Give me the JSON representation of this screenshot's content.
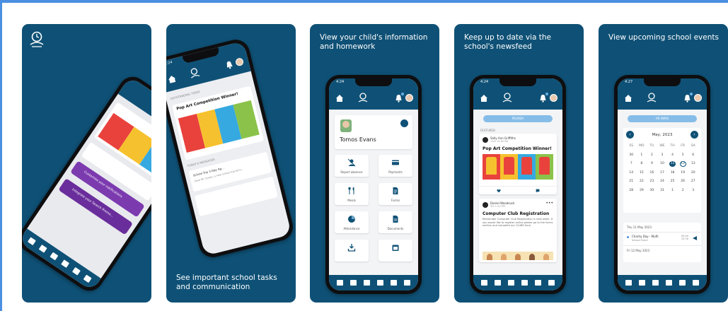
{
  "cards": [
    {
      "id": "logo"
    },
    {
      "id": "communication",
      "caption": "See important school tasks and communication"
    },
    {
      "id": "child-info",
      "caption": "View your child's information and homework"
    },
    {
      "id": "newsfeed",
      "caption": "Keep up to date via the school's newsfeed"
    },
    {
      "id": "events",
      "caption": "View upcoming school events"
    }
  ],
  "phones": {
    "time_a": "4:24",
    "time_b": "4:27"
  },
  "child_screen": {
    "child_name": "Tomos Evans",
    "tiles": [
      {
        "label": "Report absence",
        "icon": "person-off-icon"
      },
      {
        "label": "Payments",
        "icon": "card-icon"
      },
      {
        "label": "Meals",
        "icon": "cutlery-icon"
      },
      {
        "label": "Forms",
        "icon": "form-icon"
      },
      {
        "label": "Attendance",
        "icon": "pie-icon"
      },
      {
        "label": "Documents",
        "icon": "document-icon"
      },
      {
        "label": "",
        "icon": "download-icon"
      },
      {
        "label": "",
        "icon": "calendar-icon"
      }
    ]
  },
  "feed_screen": {
    "pill": "PEUADA",
    "featured": "FEATURED",
    "posts": [
      {
        "author": "Sally Ann Griffiths",
        "time": "14/5 12:00 PM",
        "title": "Pop Art Competition Winner!"
      },
      {
        "author": "Daniel Woodcock",
        "time": "9/5 1:30 PM",
        "title": "Computer Club Registration",
        "body": "Remember Computer Club Registration is next week. If you would like to register online please go to the forms section and complete our CLUBS form."
      }
    ],
    "art_colors": [
      "#e9423d",
      "#f6c12e",
      "#36a9e1",
      "#8bc34a"
    ]
  },
  "calendar_screen": {
    "pill": "AR AWAS",
    "month": "May, 2023",
    "weekdays": [
      "SS",
      "MO",
      "TU",
      "WE",
      "TH",
      "FR",
      "SA"
    ],
    "weeks": [
      [
        "30",
        "1",
        "2",
        "3",
        "4",
        "5",
        "6"
      ],
      [
        "7",
        "8",
        "9",
        "10",
        "11",
        "12",
        "13"
      ],
      [
        "14",
        "15",
        "16",
        "17",
        "18",
        "19",
        "20"
      ],
      [
        "21",
        "22",
        "23",
        "24",
        "25",
        "26",
        "27"
      ],
      [
        "28",
        "29",
        "30",
        "31",
        "1",
        "2",
        "3"
      ]
    ],
    "today": "11",
    "selected": "12",
    "events": [
      {
        "date": "Thu 11 May 2023"
      },
      {
        "title": "Charity Day - Mufti",
        "sub": "School Event",
        "time": "09:00\n15:30"
      },
      {
        "date": "Fri 12 May 2023"
      }
    ]
  },
  "tilted_screen": {
    "tasks_header": "OUTSTANDING TASKS",
    "announce_header": "TODAY'S MESSAGES",
    "banner_a": "Customise your notifications",
    "banner_b": "Integrate your Search Promo...",
    "post_title": "Pop Art Competition Winner!",
    "msg_line": "School Trip 3 Day Ag...",
    "msg_sub": "Dear Mr. Evans, a new school trip form..."
  },
  "colors": {
    "brand_navy": "#0f5176",
    "page_bg": "#ffffff",
    "accent_blue": "#4a8fe0",
    "purple": "#7c3aaf"
  }
}
